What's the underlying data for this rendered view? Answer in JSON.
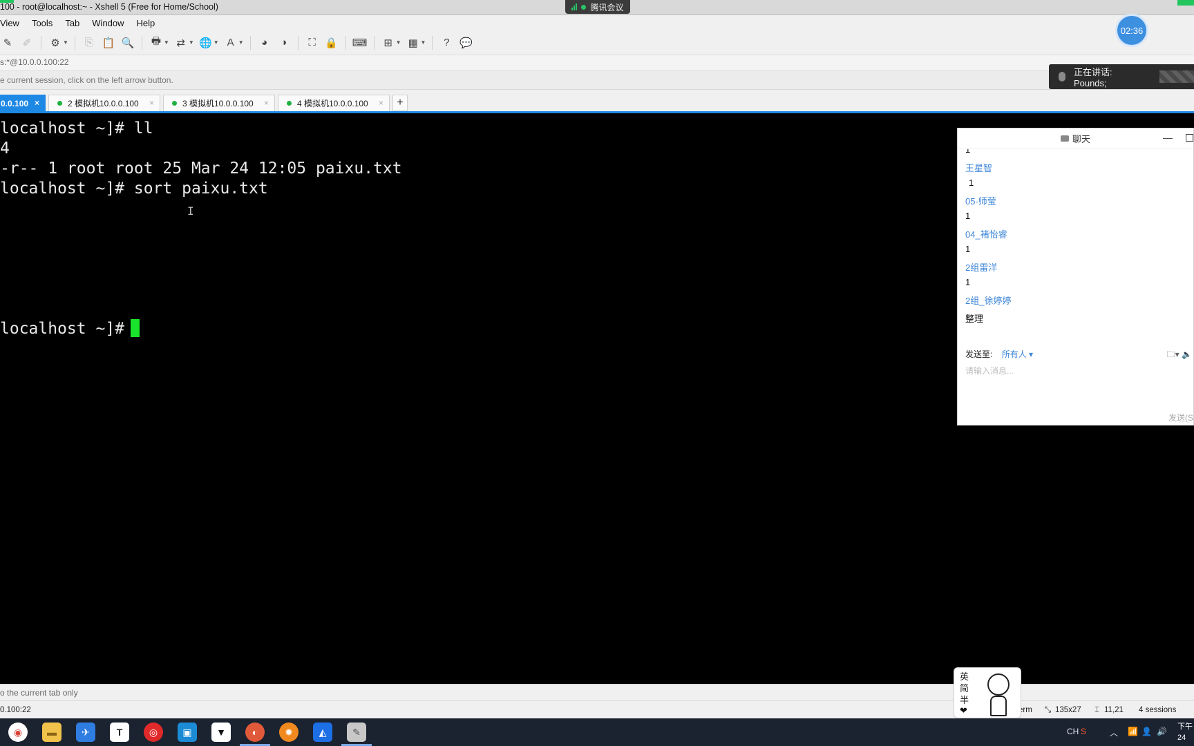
{
  "titlebar": {
    "title": "100 - root@localhost:~ - Xshell 5 (Free for Home/School)",
    "meeting": "腾讯会议"
  },
  "menu": [
    "View",
    "Tools",
    "Tab",
    "Window",
    "Help"
  ],
  "timer": "02:36",
  "address": "s:*@10.0.0.100:22",
  "hint": "e current session, click on the left arrow button.",
  "speaking": "正在讲话: Pounds;",
  "tabs": [
    {
      "label": "0.0.100",
      "active": true
    },
    {
      "label": "2 模拟机10.0.0.100"
    },
    {
      "label": "3 模拟机10.0.0.100"
    },
    {
      "label": "4 模拟机10.0.0.100"
    }
  ],
  "tab_add": "+",
  "terminal": {
    "lines": [
      "localhost ~]# ll",
      "4",
      "-r-- 1 root root 25 Mar 24 12:05 paixu.txt",
      "localhost ~]# sort paixu.txt",
      "localhost ~]# "
    ]
  },
  "chat": {
    "title": "聊天",
    "top_partial": "1",
    "messages": [
      {
        "name": "王星智",
        "text": "1"
      },
      {
        "name": "05-师莹",
        "text": "1"
      },
      {
        "name": "04_褚怡睿",
        "text": "1"
      },
      {
        "name": "2组雷洋",
        "text": "1"
      },
      {
        "name": "2组_徐婷婷",
        "text": "整理"
      }
    ],
    "send_to_label": "发送至:",
    "send_to_value": "所有人",
    "input_placeholder": "请输入消息...",
    "send_button": "发送(S"
  },
  "tip": "o the current tab only",
  "status": {
    "left": "0.100:22",
    "term": "erm",
    "size": "135x27",
    "cursor": "11,21",
    "sessions": "4 sessions"
  },
  "sticker": {
    "text": "英简半",
    "heart": "❤"
  },
  "taskbar": {
    "lang": "CH",
    "clock_top": "下午",
    "clock_bottom": "24"
  },
  "colors": {
    "accent": "#1e88e5",
    "cursor": "#19e32a",
    "chat_name": "#3d86d9"
  }
}
